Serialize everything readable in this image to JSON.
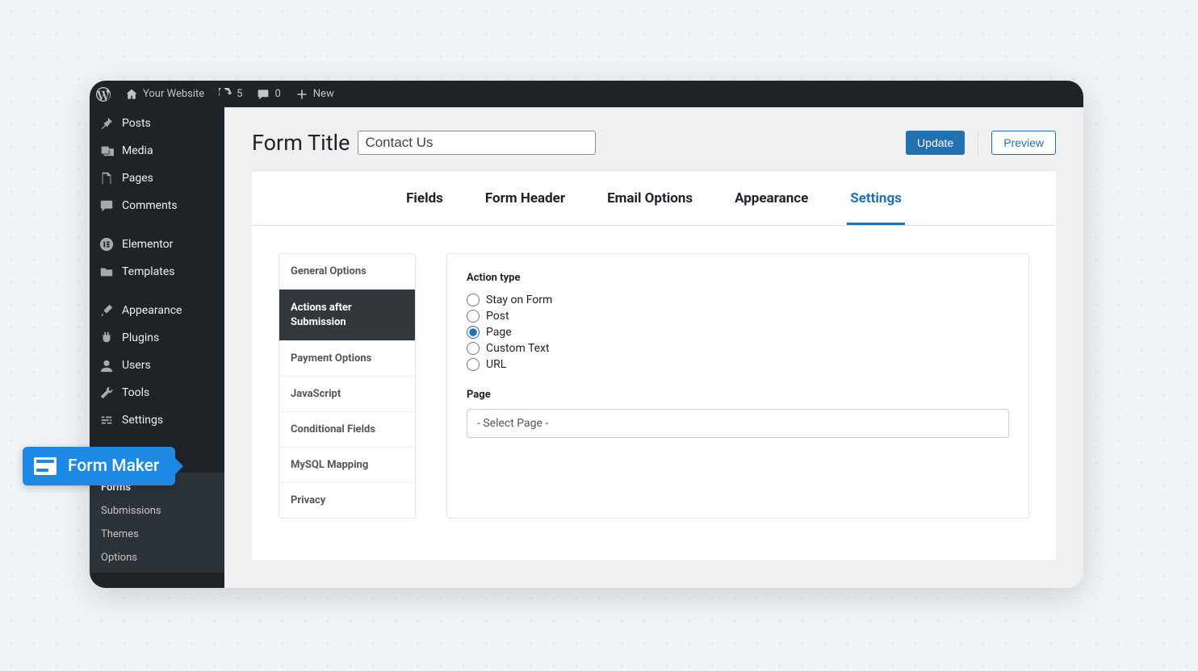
{
  "adminbar": {
    "site_name": "Your Website",
    "updates_count": "5",
    "comments_count": "0",
    "new_label": "New"
  },
  "sidebar": {
    "items": [
      {
        "label": "Posts"
      },
      {
        "label": "Media"
      },
      {
        "label": "Pages"
      },
      {
        "label": "Comments"
      },
      {
        "label": "Elementor"
      },
      {
        "label": "Templates"
      },
      {
        "label": "Appearance"
      },
      {
        "label": "Plugins"
      },
      {
        "label": "Users"
      },
      {
        "label": "Tools"
      },
      {
        "label": "Settings"
      }
    ],
    "submenu": [
      {
        "label": "Forms",
        "active": true
      },
      {
        "label": "Submissions"
      },
      {
        "label": "Themes"
      },
      {
        "label": "Options"
      }
    ]
  },
  "form_maker_pill": "Form Maker",
  "header": {
    "title_label": "Form Title",
    "title_value": "Contact Us",
    "update_label": "Update",
    "preview_label": "Preview"
  },
  "tabs": [
    {
      "label": "Fields"
    },
    {
      "label": "Form Header"
    },
    {
      "label": "Email Options"
    },
    {
      "label": "Appearance"
    },
    {
      "label": "Settings",
      "active": true
    }
  ],
  "settings_side": [
    {
      "label": "General Options"
    },
    {
      "label": "Actions after Submission",
      "active": true
    },
    {
      "label": "Payment Options"
    },
    {
      "label": "JavaScript"
    },
    {
      "label": "Conditional Fields"
    },
    {
      "label": "MySQL Mapping"
    },
    {
      "label": "Privacy"
    }
  ],
  "panel": {
    "action_type_label": "Action type",
    "radios": [
      {
        "label": "Stay on Form",
        "checked": false
      },
      {
        "label": "Post",
        "checked": false
      },
      {
        "label": "Page",
        "checked": true
      },
      {
        "label": "Custom Text",
        "checked": false
      },
      {
        "label": "URL",
        "checked": false
      }
    ],
    "page_label": "Page",
    "page_select_placeholder": "- Select Page -"
  }
}
